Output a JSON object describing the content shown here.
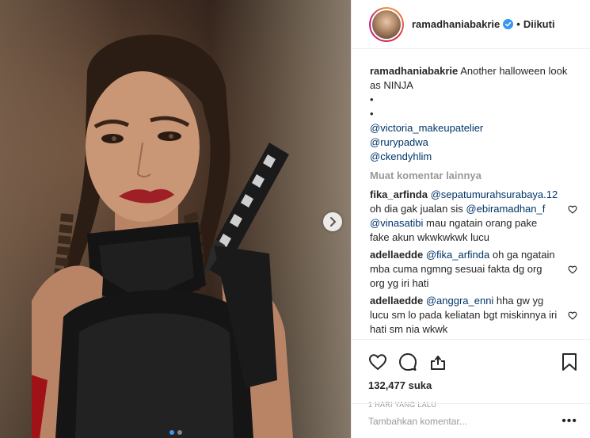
{
  "header": {
    "username": "ramadhaniabakrie",
    "separator": "•",
    "follow_status": "Diikuti"
  },
  "caption": {
    "username": "ramadhaniabakrie",
    "text": "Another halloween look as NINJA",
    "bullets": [
      "•",
      "•"
    ],
    "mentions": [
      "@victoria_makeupatelier",
      "@rurypadwa",
      "@ckendyhlim"
    ]
  },
  "load_more_label": "Muat komentar lainnya",
  "comments": [
    {
      "username": "fika_arfinda",
      "parts": [
        {
          "type": "mention",
          "text": "@sepatumurahsurabaya.12"
        },
        {
          "type": "text",
          "text": " oh dia gak jualan sis "
        },
        {
          "type": "mention",
          "text": "@ebiramadhan_f"
        },
        {
          "type": "text",
          "text": " "
        },
        {
          "type": "mention",
          "text": "@vinasatibi"
        },
        {
          "type": "text",
          "text": " mau ngatain orang pake fake akun wkwkwkwk lucu"
        }
      ]
    },
    {
      "username": "adellaedde",
      "parts": [
        {
          "type": "mention",
          "text": "@fika_arfinda"
        },
        {
          "type": "text",
          "text": " oh ga ngatain mba cuma ngmng sesuai fakta dg org org yg iri hati"
        }
      ]
    },
    {
      "username": "adellaedde",
      "parts": [
        {
          "type": "mention",
          "text": "@anggra_enni"
        },
        {
          "type": "text",
          "text": " hha gw yg lucu sm lo pada keliatan bgt miskinnya iri hati sm nia wkwk"
        }
      ]
    }
  ],
  "likes": "132,477 suka",
  "timestamp": "1 HARI YANG LALU",
  "add_comment": {
    "placeholder": "Tambahkan komentar..."
  },
  "more_label": "•••",
  "carousel": {
    "slides": 2,
    "active_slide": 1
  },
  "colors": {
    "verified_blue": "#3897f0",
    "mention": "#003569",
    "muted": "#999999"
  },
  "icons": [
    "heart-icon",
    "comment-icon",
    "share-icon",
    "bookmark-icon",
    "verified-icon",
    "chevron-right-icon"
  ]
}
